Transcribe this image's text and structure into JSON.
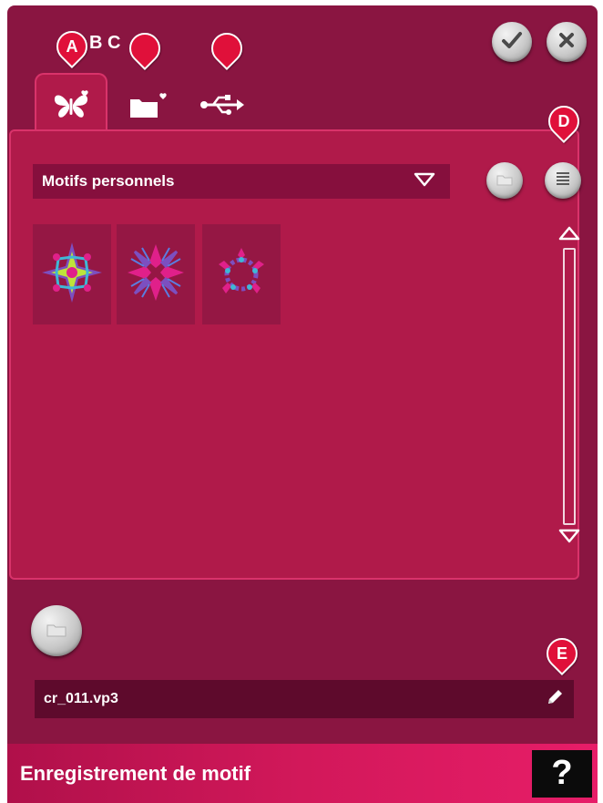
{
  "window": {
    "title": "Enregistrement de motif",
    "help_label": "?"
  },
  "callouts": {
    "a": "A",
    "b": "B",
    "c": "C",
    "d": "D",
    "e": "E"
  },
  "tabs": [
    {
      "id": "personal",
      "icon": "butterfly-heart-icon",
      "selected": true
    },
    {
      "id": "files",
      "icon": "folder-heart-icon",
      "selected": false
    },
    {
      "id": "usb",
      "icon": "usb-icon",
      "selected": false
    }
  ],
  "toolbar": {
    "confirm_icon": "check-icon",
    "cancel_icon": "close-icon"
  },
  "browser": {
    "location_label": "Motifs personnels",
    "up_icon": "folder-up-icon",
    "list_view_icon": "list-view-icon",
    "thumbnails": [
      {
        "name": "design-1",
        "icon": "embroidery-star-icon"
      },
      {
        "name": "design-2",
        "icon": "embroidery-cross-icon"
      },
      {
        "name": "design-3",
        "icon": "embroidery-wreath-icon"
      }
    ]
  },
  "save": {
    "new_folder_icon": "new-folder-icon",
    "filename": "cr_011.vp3",
    "edit_icon": "pencil-icon"
  },
  "colors": {
    "background": "#8a1541",
    "panel": "#b01a4a",
    "accent": "#e0103a",
    "footer": "#d2185a"
  }
}
